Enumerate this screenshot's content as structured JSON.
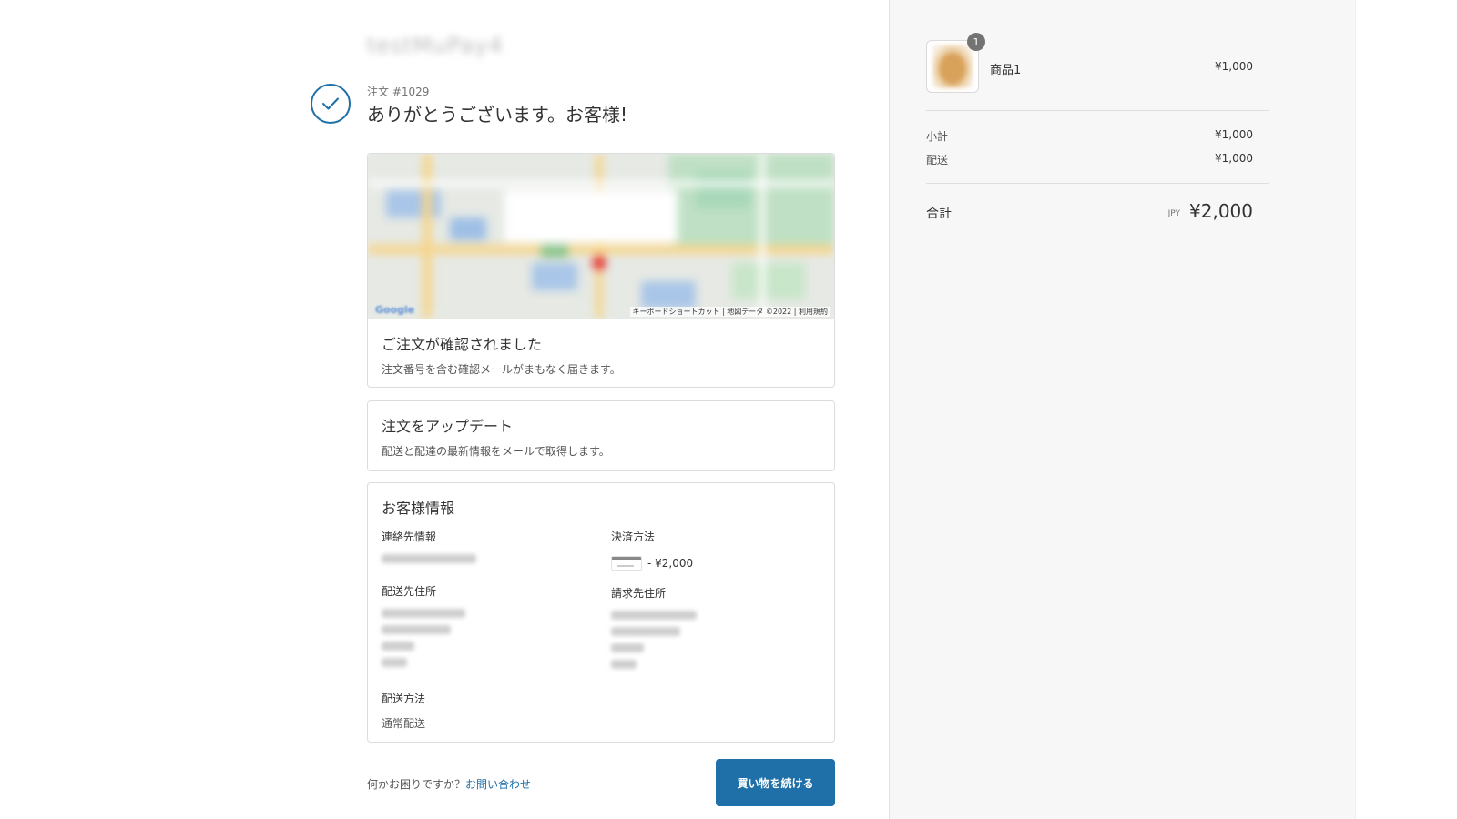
{
  "shop": {
    "name": "testMuPay4"
  },
  "order": {
    "number": "注文 #1029",
    "thanks": "ありがとうございます。お客様!"
  },
  "map": {
    "footer": "キーボードショートカット | 地図データ ©2022 | 利用規約",
    "logo": "Google"
  },
  "confirmed": {
    "title": "ご注文が確認されました",
    "text": "注文番号を含む確認メールがまもなく届きます。"
  },
  "update": {
    "title": "注文をアップデート",
    "text": "配送と配達の最新情報をメールで取得します。"
  },
  "customer": {
    "title": "お客様情報",
    "contact_label": "連絡先情報",
    "payment_label": "決済方法",
    "payment_amount": "- ¥2,000",
    "shipping_address_label": "配送先住所",
    "billing_address_label": "請求先住所",
    "shipping_method_label": "配送方法",
    "shipping_method_value": "通常配送"
  },
  "footer": {
    "help_text": "何かお困りですか？",
    "help_link": "お問い合わせ",
    "continue_button": "買い物を続ける"
  },
  "sidebar": {
    "product_qty": "1",
    "product_name": "商品1",
    "product_price": "¥1,000",
    "subtotal_label": "小計",
    "subtotal_value": "¥1,000",
    "shipping_label": "配送",
    "shipping_value": "¥1,000",
    "total_label": "合計",
    "total_currency": "JPY",
    "total_value": "¥2,000"
  },
  "colors": {
    "accent": "#1f6fa8",
    "sidebar_bg": "#f7f7f7",
    "border": "#dcdcdc"
  },
  "icons": {
    "check": "checkmark-circle-icon",
    "map_pin": "map-pin-icon",
    "payment_card": "credit-card-icon"
  }
}
